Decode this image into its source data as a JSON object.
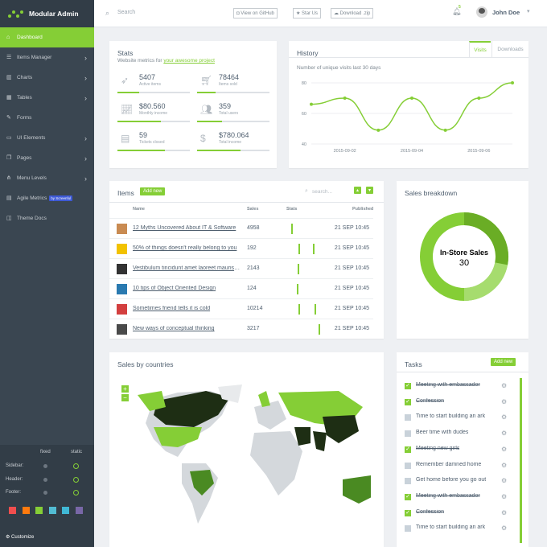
{
  "app": {
    "name": "Modular Admin"
  },
  "sidebar": {
    "items": [
      {
        "label": "Dashboard",
        "chevron": ""
      },
      {
        "label": "Items Manager",
        "chevron": "›"
      },
      {
        "label": "Charts",
        "chevron": "›"
      },
      {
        "label": "Tables",
        "chevron": "›"
      },
      {
        "label": "Forms",
        "chevron": ""
      },
      {
        "label": "UI Elements",
        "chevron": "›"
      },
      {
        "label": "Pages",
        "chevron": "›"
      },
      {
        "label": "Menu Levels",
        "chevron": "›"
      },
      {
        "label": "Agile Metrics",
        "badge": "by Screenful",
        "chevron": ""
      },
      {
        "label": "Theme Docs",
        "chevron": ""
      }
    ],
    "customize": {
      "col_fixed": "fixed",
      "col_static": "static",
      "rows": [
        "Sidebar:",
        "Header:",
        "Footer:"
      ],
      "label": "Customize",
      "swatches": [
        "#f14e4e",
        "#fe7a0e",
        "#85ce36",
        "#52bcd3",
        "#40b8d5",
        "#7867a7"
      ]
    }
  },
  "header": {
    "search_placeholder": "Search",
    "github": "View on GitHub",
    "star": "Star Us",
    "download": "Download .zip",
    "notif_count": "5",
    "user": "John Doe"
  },
  "stats": {
    "title": "Stats",
    "subtitle_prefix": "Website metrics for ",
    "subtitle_link": "your awesome project",
    "items": [
      {
        "value": "5407",
        "label": "Active items",
        "progress": 0.3
      },
      {
        "value": "78464",
        "label": "Items sold",
        "progress": 0.25
      },
      {
        "value": "$80.560",
        "label": "Monthly income",
        "progress": 0.6
      },
      {
        "value": "359",
        "label": "Total users",
        "progress": 0.34
      },
      {
        "value": "59",
        "label": "Tickets closed",
        "progress": 0.65
      },
      {
        "value": "$780.064",
        "label": "Total income",
        "progress": 0.6
      }
    ]
  },
  "history": {
    "title": "History",
    "tabs": [
      "Visits",
      "Downloads"
    ],
    "caption": "Number of unique visits last 30 days"
  },
  "chart_data": {
    "type": "line",
    "title": "",
    "yticks": [
      "80",
      "60",
      "40"
    ],
    "ylim": [
      40,
      80
    ],
    "xticks": [
      "2015-09-02",
      "2015-09-04",
      "2015-09-06"
    ],
    "x": [
      "2015-09-01",
      "2015-09-02",
      "2015-09-03",
      "2015-09-04",
      "2015-09-05",
      "2015-09-06",
      "2015-09-07"
    ],
    "values": [
      66,
      70,
      49,
      70,
      49,
      70,
      80
    ]
  },
  "items": {
    "title": "Items",
    "add": "Add new",
    "search_placeholder": "search...",
    "columns": [
      "Name",
      "Sales",
      "Stats",
      "Published"
    ],
    "rows": [
      {
        "name": "12 Myths Uncovered About IT & Software",
        "sales": "4958",
        "date": "21 SEP 10:45",
        "thumb": "#c98b52"
      },
      {
        "name": "50% of things doesn't really belong to you",
        "sales": "192",
        "date": "21 SEP 10:45",
        "thumb": "#f2c200"
      },
      {
        "name": "Vestibulum tincidunt amet laoreet mauris sit sem aliquam cras maecenas vel aliquam.",
        "sales": "2143",
        "date": "21 SEP 10:45",
        "thumb": "#333333"
      },
      {
        "name": "10 tips of Object Oriented Design",
        "sales": "124",
        "date": "21 SEP 10:45",
        "thumb": "#2a7ab0"
      },
      {
        "name": "Sometimes friend tells it is cold",
        "sales": "10214",
        "date": "21 SEP 10:45",
        "thumb": "#d33f3f"
      },
      {
        "name": "New ways of conceptual thinking",
        "sales": "3217",
        "date": "21 SEP 10:45",
        "thumb": "#4a4a4a"
      }
    ]
  },
  "breakdown": {
    "title": "Sales breakdown",
    "center_label": "In-Store Sales",
    "center_value": "30"
  },
  "countries": {
    "title": "Sales by countries",
    "zoom_in": "+",
    "zoom_out": "−"
  },
  "tasks": {
    "title": "Tasks",
    "add": "Add new",
    "items": [
      {
        "text": "Meeting with embassador",
        "done": true
      },
      {
        "text": "Confession",
        "done": true
      },
      {
        "text": "Time to start building an ark",
        "done": false
      },
      {
        "text": "Beer time with dudes",
        "done": false
      },
      {
        "text": "Meeting new girls",
        "done": true
      },
      {
        "text": "Remember damned home",
        "done": false
      },
      {
        "text": "Get home before you go out",
        "done": false
      },
      {
        "text": "Meeting with embassador",
        "done": true
      },
      {
        "text": "Confession",
        "done": true
      },
      {
        "text": "Time to start building an ark",
        "done": false
      }
    ]
  }
}
